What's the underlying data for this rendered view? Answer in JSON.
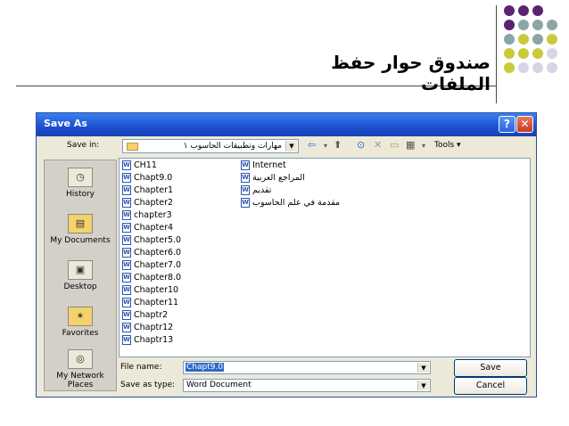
{
  "slide": {
    "title": "صندوق حوار حفظ الملفات",
    "dot_colors": [
      "#5a2470",
      "#8aa6a6",
      "#c9c93c",
      "#d8d4e6"
    ]
  },
  "dialog": {
    "title": "Save As",
    "help_label": "?",
    "close_label": "✕",
    "save_in_label": "Save in:",
    "save_in_value": "مهارات وتطبيقات الحاسوب ١",
    "tools_label": "Tools ▾",
    "places": [
      {
        "label": "History",
        "icon": "history-icon"
      },
      {
        "label": "My Documents",
        "icon": "my-documents-icon"
      },
      {
        "label": "Desktop",
        "icon": "desktop-icon"
      },
      {
        "label": "Favorites",
        "icon": "favorites-icon"
      },
      {
        "label": "My Network Places",
        "icon": "network-places-icon"
      }
    ],
    "files_col1": [
      "CH11",
      "Chapt9.0",
      "Chapter1",
      "Chapter2",
      "chapter3",
      "Chapter4",
      "Chapter5.0",
      "Chapter6.0",
      "Chapter7.0",
      "Chapter8.0",
      "Chapter10",
      "Chapter11",
      "Chaptr2",
      "Chaptr12",
      "Chaptr13"
    ],
    "files_col2": [
      "Internet",
      "المراجع العربية",
      "تقديم",
      "مقدمة في علم الحاسوب"
    ],
    "file_name_label": "File name:",
    "file_name_value": "Chapt9.0",
    "save_as_type_label": "Save as type:",
    "save_as_type_value": "Word Document",
    "save_button": "Save",
    "cancel_button": "Cancel"
  }
}
